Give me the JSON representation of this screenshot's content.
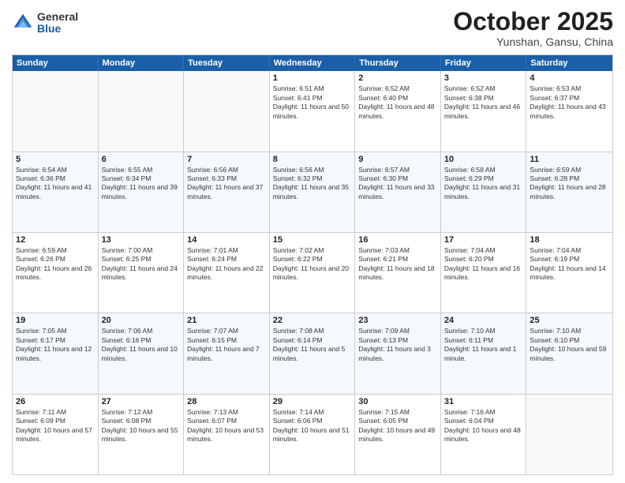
{
  "logo": {
    "general": "General",
    "blue": "Blue"
  },
  "title": {
    "month": "October 2025",
    "location": "Yunshan, Gansu, China"
  },
  "weekdays": [
    "Sunday",
    "Monday",
    "Tuesday",
    "Wednesday",
    "Thursday",
    "Friday",
    "Saturday"
  ],
  "weeks": [
    [
      {
        "day": "",
        "sunrise": "",
        "sunset": "",
        "daylight": "",
        "empty": true
      },
      {
        "day": "",
        "sunrise": "",
        "sunset": "",
        "daylight": "",
        "empty": true
      },
      {
        "day": "",
        "sunrise": "",
        "sunset": "",
        "daylight": "",
        "empty": true
      },
      {
        "day": "1",
        "sunrise": "Sunrise: 6:51 AM",
        "sunset": "Sunset: 6:41 PM",
        "daylight": "Daylight: 11 hours and 50 minutes.",
        "empty": false
      },
      {
        "day": "2",
        "sunrise": "Sunrise: 6:52 AM",
        "sunset": "Sunset: 6:40 PM",
        "daylight": "Daylight: 11 hours and 48 minutes.",
        "empty": false
      },
      {
        "day": "3",
        "sunrise": "Sunrise: 6:52 AM",
        "sunset": "Sunset: 6:38 PM",
        "daylight": "Daylight: 11 hours and 46 minutes.",
        "empty": false
      },
      {
        "day": "4",
        "sunrise": "Sunrise: 6:53 AM",
        "sunset": "Sunset: 6:37 PM",
        "daylight": "Daylight: 11 hours and 43 minutes.",
        "empty": false
      }
    ],
    [
      {
        "day": "5",
        "sunrise": "Sunrise: 6:54 AM",
        "sunset": "Sunset: 6:36 PM",
        "daylight": "Daylight: 11 hours and 41 minutes.",
        "empty": false
      },
      {
        "day": "6",
        "sunrise": "Sunrise: 6:55 AM",
        "sunset": "Sunset: 6:34 PM",
        "daylight": "Daylight: 11 hours and 39 minutes.",
        "empty": false
      },
      {
        "day": "7",
        "sunrise": "Sunrise: 6:56 AM",
        "sunset": "Sunset: 6:33 PM",
        "daylight": "Daylight: 11 hours and 37 minutes.",
        "empty": false
      },
      {
        "day": "8",
        "sunrise": "Sunrise: 6:56 AM",
        "sunset": "Sunset: 6:32 PM",
        "daylight": "Daylight: 11 hours and 35 minutes.",
        "empty": false
      },
      {
        "day": "9",
        "sunrise": "Sunrise: 6:57 AM",
        "sunset": "Sunset: 6:30 PM",
        "daylight": "Daylight: 11 hours and 33 minutes.",
        "empty": false
      },
      {
        "day": "10",
        "sunrise": "Sunrise: 6:58 AM",
        "sunset": "Sunset: 6:29 PM",
        "daylight": "Daylight: 11 hours and 31 minutes.",
        "empty": false
      },
      {
        "day": "11",
        "sunrise": "Sunrise: 6:59 AM",
        "sunset": "Sunset: 6:28 PM",
        "daylight": "Daylight: 11 hours and 28 minutes.",
        "empty": false
      }
    ],
    [
      {
        "day": "12",
        "sunrise": "Sunrise: 6:59 AM",
        "sunset": "Sunset: 6:26 PM",
        "daylight": "Daylight: 11 hours and 26 minutes.",
        "empty": false
      },
      {
        "day": "13",
        "sunrise": "Sunrise: 7:00 AM",
        "sunset": "Sunset: 6:25 PM",
        "daylight": "Daylight: 11 hours and 24 minutes.",
        "empty": false
      },
      {
        "day": "14",
        "sunrise": "Sunrise: 7:01 AM",
        "sunset": "Sunset: 6:24 PM",
        "daylight": "Daylight: 11 hours and 22 minutes.",
        "empty": false
      },
      {
        "day": "15",
        "sunrise": "Sunrise: 7:02 AM",
        "sunset": "Sunset: 6:22 PM",
        "daylight": "Daylight: 11 hours and 20 minutes.",
        "empty": false
      },
      {
        "day": "16",
        "sunrise": "Sunrise: 7:03 AM",
        "sunset": "Sunset: 6:21 PM",
        "daylight": "Daylight: 11 hours and 18 minutes.",
        "empty": false
      },
      {
        "day": "17",
        "sunrise": "Sunrise: 7:04 AM",
        "sunset": "Sunset: 6:20 PM",
        "daylight": "Daylight: 11 hours and 16 minutes.",
        "empty": false
      },
      {
        "day": "18",
        "sunrise": "Sunrise: 7:04 AM",
        "sunset": "Sunset: 6:19 PM",
        "daylight": "Daylight: 11 hours and 14 minutes.",
        "empty": false
      }
    ],
    [
      {
        "day": "19",
        "sunrise": "Sunrise: 7:05 AM",
        "sunset": "Sunset: 6:17 PM",
        "daylight": "Daylight: 11 hours and 12 minutes.",
        "empty": false
      },
      {
        "day": "20",
        "sunrise": "Sunrise: 7:06 AM",
        "sunset": "Sunset: 6:16 PM",
        "daylight": "Daylight: 11 hours and 10 minutes.",
        "empty": false
      },
      {
        "day": "21",
        "sunrise": "Sunrise: 7:07 AM",
        "sunset": "Sunset: 6:15 PM",
        "daylight": "Daylight: 11 hours and 7 minutes.",
        "empty": false
      },
      {
        "day": "22",
        "sunrise": "Sunrise: 7:08 AM",
        "sunset": "Sunset: 6:14 PM",
        "daylight": "Daylight: 11 hours and 5 minutes.",
        "empty": false
      },
      {
        "day": "23",
        "sunrise": "Sunrise: 7:09 AM",
        "sunset": "Sunset: 6:13 PM",
        "daylight": "Daylight: 11 hours and 3 minutes.",
        "empty": false
      },
      {
        "day": "24",
        "sunrise": "Sunrise: 7:10 AM",
        "sunset": "Sunset: 6:11 PM",
        "daylight": "Daylight: 11 hours and 1 minute.",
        "empty": false
      },
      {
        "day": "25",
        "sunrise": "Sunrise: 7:10 AM",
        "sunset": "Sunset: 6:10 PM",
        "daylight": "Daylight: 10 hours and 59 minutes.",
        "empty": false
      }
    ],
    [
      {
        "day": "26",
        "sunrise": "Sunrise: 7:11 AM",
        "sunset": "Sunset: 6:09 PM",
        "daylight": "Daylight: 10 hours and 57 minutes.",
        "empty": false
      },
      {
        "day": "27",
        "sunrise": "Sunrise: 7:12 AM",
        "sunset": "Sunset: 6:08 PM",
        "daylight": "Daylight: 10 hours and 55 minutes.",
        "empty": false
      },
      {
        "day": "28",
        "sunrise": "Sunrise: 7:13 AM",
        "sunset": "Sunset: 6:07 PM",
        "daylight": "Daylight: 10 hours and 53 minutes.",
        "empty": false
      },
      {
        "day": "29",
        "sunrise": "Sunrise: 7:14 AM",
        "sunset": "Sunset: 6:06 PM",
        "daylight": "Daylight: 10 hours and 51 minutes.",
        "empty": false
      },
      {
        "day": "30",
        "sunrise": "Sunrise: 7:15 AM",
        "sunset": "Sunset: 6:05 PM",
        "daylight": "Daylight: 10 hours and 49 minutes.",
        "empty": false
      },
      {
        "day": "31",
        "sunrise": "Sunrise: 7:16 AM",
        "sunset": "Sunset: 6:04 PM",
        "daylight": "Daylight: 10 hours and 48 minutes.",
        "empty": false
      },
      {
        "day": "",
        "sunrise": "",
        "sunset": "",
        "daylight": "",
        "empty": true
      }
    ]
  ]
}
